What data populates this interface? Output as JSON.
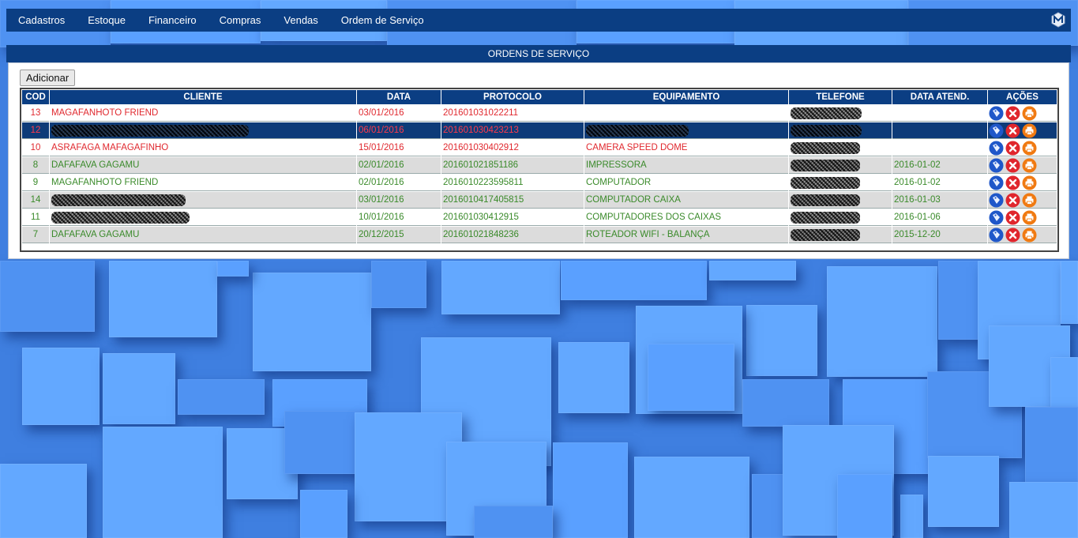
{
  "nav": {
    "items": [
      "Cadastros",
      "Estoque",
      "Financeiro",
      "Compras",
      "Vendas",
      "Ordem de Serviço"
    ]
  },
  "panel": {
    "title": "ORDENS DE SERVIÇO",
    "add_label": "Adicionar"
  },
  "table": {
    "headers": [
      "COD",
      "CLIENTE",
      "DATA",
      "PROTOCOLO",
      "EQUIPAMENTO",
      "TELEFONE",
      "DATA ATEND.",
      "AÇÕES"
    ],
    "rows": [
      {
        "cod": "13",
        "cliente": "MAGAFANHOTO FRIEND",
        "data": "03/01/2016",
        "protocolo": "201601031022211",
        "equipamento": "",
        "telefone": "",
        "data_atend": "",
        "status": "red"
      },
      {
        "cod": "12",
        "cliente": "",
        "data": "06/01/2016",
        "protocolo": "201601030423213",
        "equipamento": "",
        "telefone": "",
        "data_atend": "",
        "status": "selected"
      },
      {
        "cod": "10",
        "cliente": "ASRAFAGA MAFAGAFINHO",
        "data": "15/01/2016",
        "protocolo": "201601030402912",
        "equipamento": "CAMERA SPEED DOME",
        "telefone": "",
        "data_atend": "",
        "status": "red"
      },
      {
        "cod": "8",
        "cliente": "DAFAFAVA GAGAMU",
        "data": "02/01/2016",
        "protocolo": "201601021851186",
        "equipamento": "IMPRESSORA",
        "telefone": "",
        "data_atend": "2016-01-02",
        "status": "green-alt"
      },
      {
        "cod": "9",
        "cliente": "MAGAFANHOTO FRIEND",
        "data": "02/01/2016",
        "protocolo": "2016010223595811",
        "equipamento": "COMPUTADOR",
        "telefone": "",
        "data_atend": "2016-01-02",
        "status": "green"
      },
      {
        "cod": "14",
        "cliente": "",
        "data": "03/01/2016",
        "protocolo": "2016010417405815",
        "equipamento": "COMPUTADOR CAIXA",
        "telefone": "",
        "data_atend": "2016-01-03",
        "status": "green-alt"
      },
      {
        "cod": "11",
        "cliente": "",
        "data": "10/01/2016",
        "protocolo": "201601030412915",
        "equipamento": "COMPUTADORES DOS CAIXAS",
        "telefone": "",
        "data_atend": "2016-01-06",
        "status": "green"
      },
      {
        "cod": "7",
        "cliente": "DAFAFAVA GAGAMU",
        "data": "20/12/2015",
        "protocolo": "201601021848236",
        "equipamento": "ROTEADOR WIFI - BALANÇA",
        "telefone": "",
        "data_atend": "2015-12-20",
        "status": "green-alt"
      }
    ]
  },
  "icons": {
    "tag": "tag-icon",
    "delete": "delete-icon",
    "print": "print-icon",
    "logo": "logo-icon"
  },
  "colors": {
    "nav_bg": "#0b3e83",
    "red_text": "#e0282e",
    "green_text": "#3a8a2a",
    "selected_bg": "#0d3b78"
  }
}
